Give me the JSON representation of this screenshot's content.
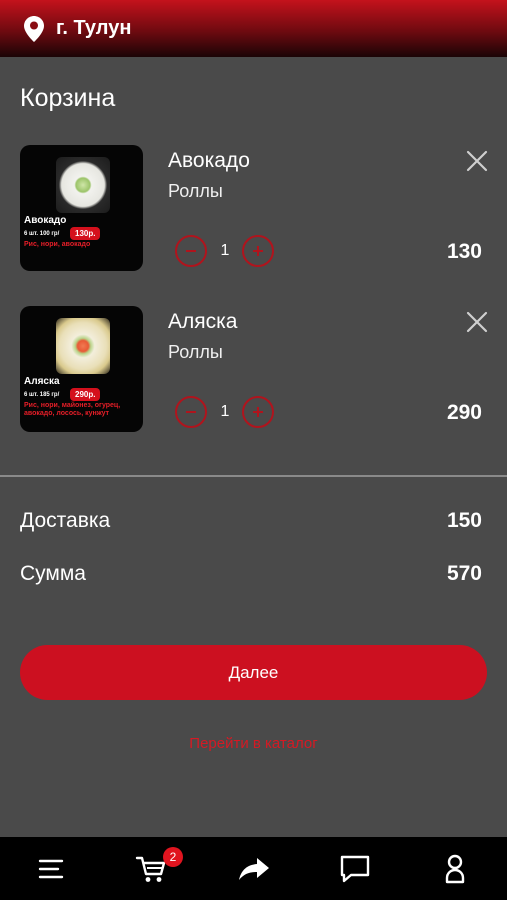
{
  "header": {
    "city": "г. Тулун",
    "icon": "location-pin-icon"
  },
  "page": {
    "title": "Корзина"
  },
  "cart": {
    "items": [
      {
        "name": "Авокадо",
        "category": "Роллы",
        "quantity": "1",
        "price": "130",
        "thumb": {
          "name": "Авокадо",
          "weight": "6 шт. 100 гр/",
          "price": "130р.",
          "description": "Рис, нори, авокадо"
        }
      },
      {
        "name": "Аляска",
        "category": "Роллы",
        "quantity": "1",
        "price": "290",
        "thumb": {
          "name": "Аляска",
          "weight": "6 шт. 185 гр/",
          "price": "290р.",
          "description": "Рис, нори, майонез, огурец, авокадо, лосось, кунжут"
        }
      }
    ]
  },
  "summary": {
    "delivery_label": "Доставка",
    "delivery_value": "150",
    "total_label": "Сумма",
    "total_value": "570"
  },
  "actions": {
    "next_label": "Далее",
    "catalog_link": "Перейти в каталог"
  },
  "tabbar": {
    "cart_badge": "2",
    "tabs": [
      "menu-icon",
      "cart-icon",
      "share-icon",
      "chat-icon",
      "profile-icon"
    ]
  },
  "colors": {
    "accent": "#cc1020",
    "background": "#4a4a4a",
    "tabbar": "#000000"
  }
}
